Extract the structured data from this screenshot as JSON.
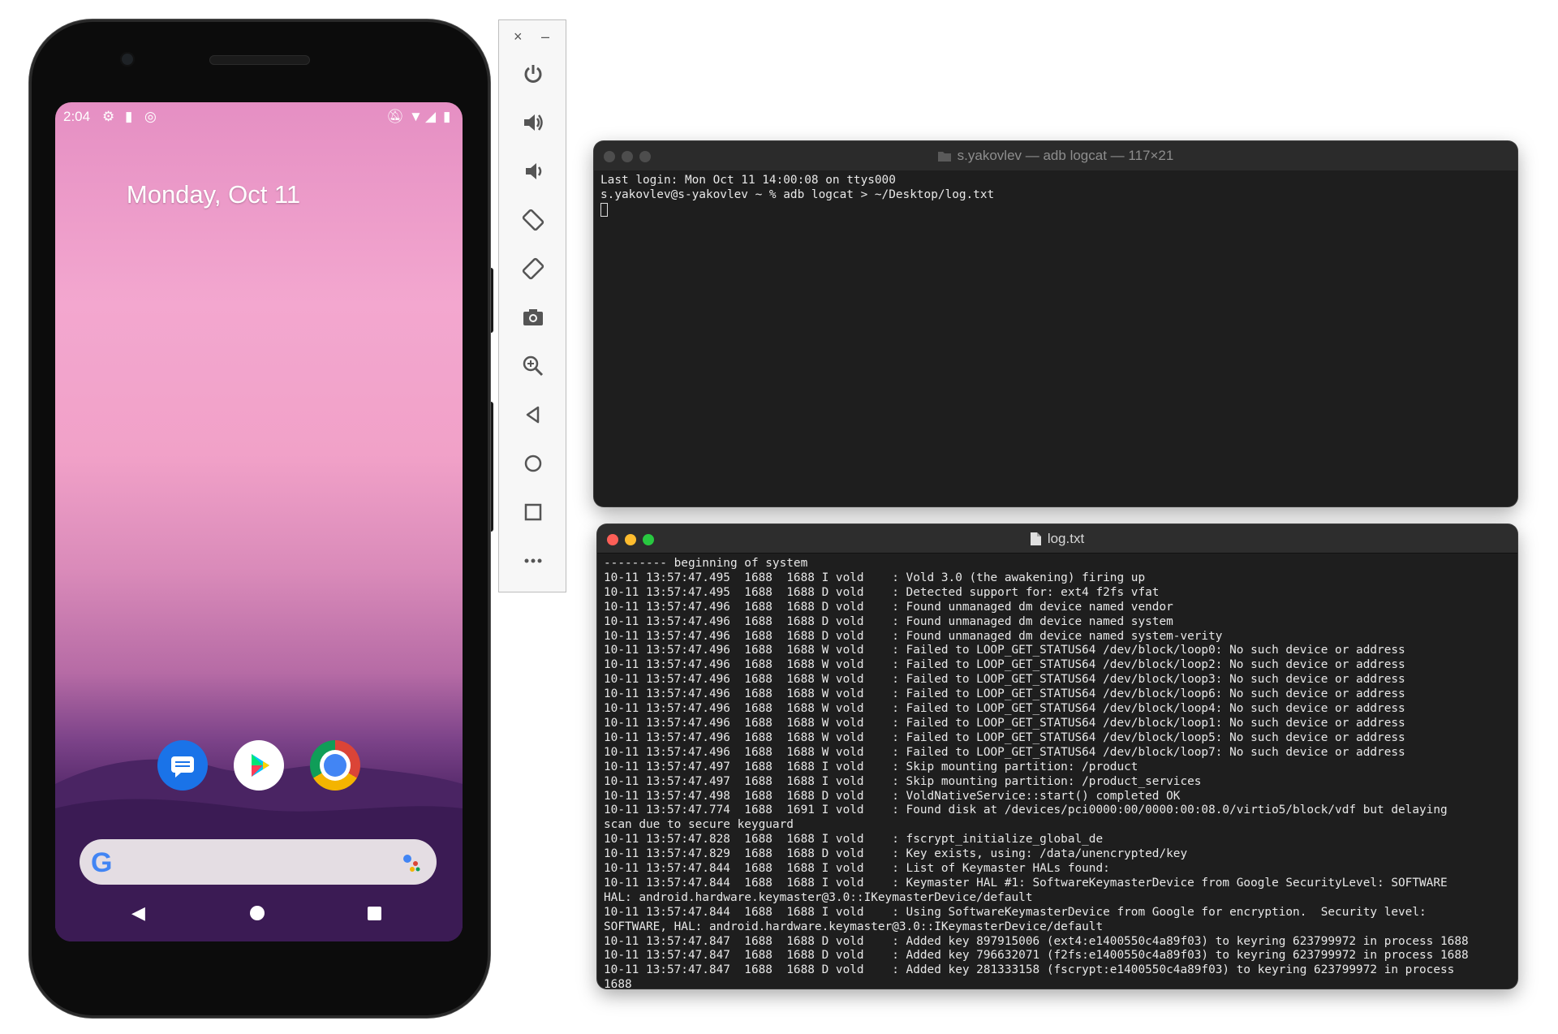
{
  "phone": {
    "status_time": "2:04",
    "date": "Monday, Oct 11",
    "apps": [
      "messages-icon",
      "play-store-icon",
      "chrome-icon"
    ],
    "search_logo": "G"
  },
  "emulator_toolbar": {
    "close": "×",
    "minimize": "–",
    "buttons": [
      "power-icon",
      "volume-up-icon",
      "volume-down-icon",
      "rotate-left-icon",
      "rotate-right-icon",
      "camera-icon",
      "zoom-icon",
      "back-icon",
      "home-icon",
      "overview-icon",
      "more-icon"
    ]
  },
  "terminal": {
    "title": "s.yakovlev — adb logcat — 117×21",
    "lines": [
      "Last login: Mon Oct 11 14:00:08 on ttys000",
      "s.yakovlev@s-yakovlev ~ % adb logcat > ~/Desktop/log.txt"
    ]
  },
  "logfile": {
    "title": "log.txt",
    "lines": [
      "--------- beginning of system",
      "10-11 13:57:47.495  1688  1688 I vold    : Vold 3.0 (the awakening) firing up",
      "10-11 13:57:47.495  1688  1688 D vold    : Detected support for: ext4 f2fs vfat",
      "10-11 13:57:47.496  1688  1688 D vold    : Found unmanaged dm device named vendor",
      "10-11 13:57:47.496  1688  1688 D vold    : Found unmanaged dm device named system",
      "10-11 13:57:47.496  1688  1688 D vold    : Found unmanaged dm device named system-verity",
      "10-11 13:57:47.496  1688  1688 W vold    : Failed to LOOP_GET_STATUS64 /dev/block/loop0: No such device or address",
      "10-11 13:57:47.496  1688  1688 W vold    : Failed to LOOP_GET_STATUS64 /dev/block/loop2: No such device or address",
      "10-11 13:57:47.496  1688  1688 W vold    : Failed to LOOP_GET_STATUS64 /dev/block/loop3: No such device or address",
      "10-11 13:57:47.496  1688  1688 W vold    : Failed to LOOP_GET_STATUS64 /dev/block/loop6: No such device or address",
      "10-11 13:57:47.496  1688  1688 W vold    : Failed to LOOP_GET_STATUS64 /dev/block/loop4: No such device or address",
      "10-11 13:57:47.496  1688  1688 W vold    : Failed to LOOP_GET_STATUS64 /dev/block/loop1: No such device or address",
      "10-11 13:57:47.496  1688  1688 W vold    : Failed to LOOP_GET_STATUS64 /dev/block/loop5: No such device or address",
      "10-11 13:57:47.496  1688  1688 W vold    : Failed to LOOP_GET_STATUS64 /dev/block/loop7: No such device or address",
      "10-11 13:57:47.497  1688  1688 I vold    : Skip mounting partition: /product",
      "10-11 13:57:47.497  1688  1688 I vold    : Skip mounting partition: /product_services",
      "10-11 13:57:47.498  1688  1688 D vold    : VoldNativeService::start() completed OK",
      "10-11 13:57:47.774  1688  1691 I vold    : Found disk at /devices/pci0000:00/0000:00:08.0/virtio5/block/vdf but delaying",
      "scan due to secure keyguard",
      "10-11 13:57:47.828  1688  1688 I vold    : fscrypt_initialize_global_de",
      "10-11 13:57:47.829  1688  1688 D vold    : Key exists, using: /data/unencrypted/key",
      "10-11 13:57:47.844  1688  1688 I vold    : List of Keymaster HALs found:",
      "10-11 13:57:47.844  1688  1688 I vold    : Keymaster HAL #1: SoftwareKeymasterDevice from Google SecurityLevel: SOFTWARE",
      "HAL: android.hardware.keymaster@3.0::IKeymasterDevice/default",
      "10-11 13:57:47.844  1688  1688 I vold    : Using SoftwareKeymasterDevice from Google for encryption.  Security level:",
      "SOFTWARE, HAL: android.hardware.keymaster@3.0::IKeymasterDevice/default",
      "10-11 13:57:47.847  1688  1688 D vold    : Added key 897915006 (ext4:e1400550c4a89f03) to keyring 623799972 in process 1688",
      "10-11 13:57:47.847  1688  1688 D vold    : Added key 796632071 (f2fs:e1400550c4a89f03) to keyring 623799972 in process 1688",
      "10-11 13:57:47.847  1688  1688 D vold    : Added key 281333158 (fscrypt:e1400550c4a89f03) to keyring 623799972 in process",
      "1688"
    ]
  }
}
